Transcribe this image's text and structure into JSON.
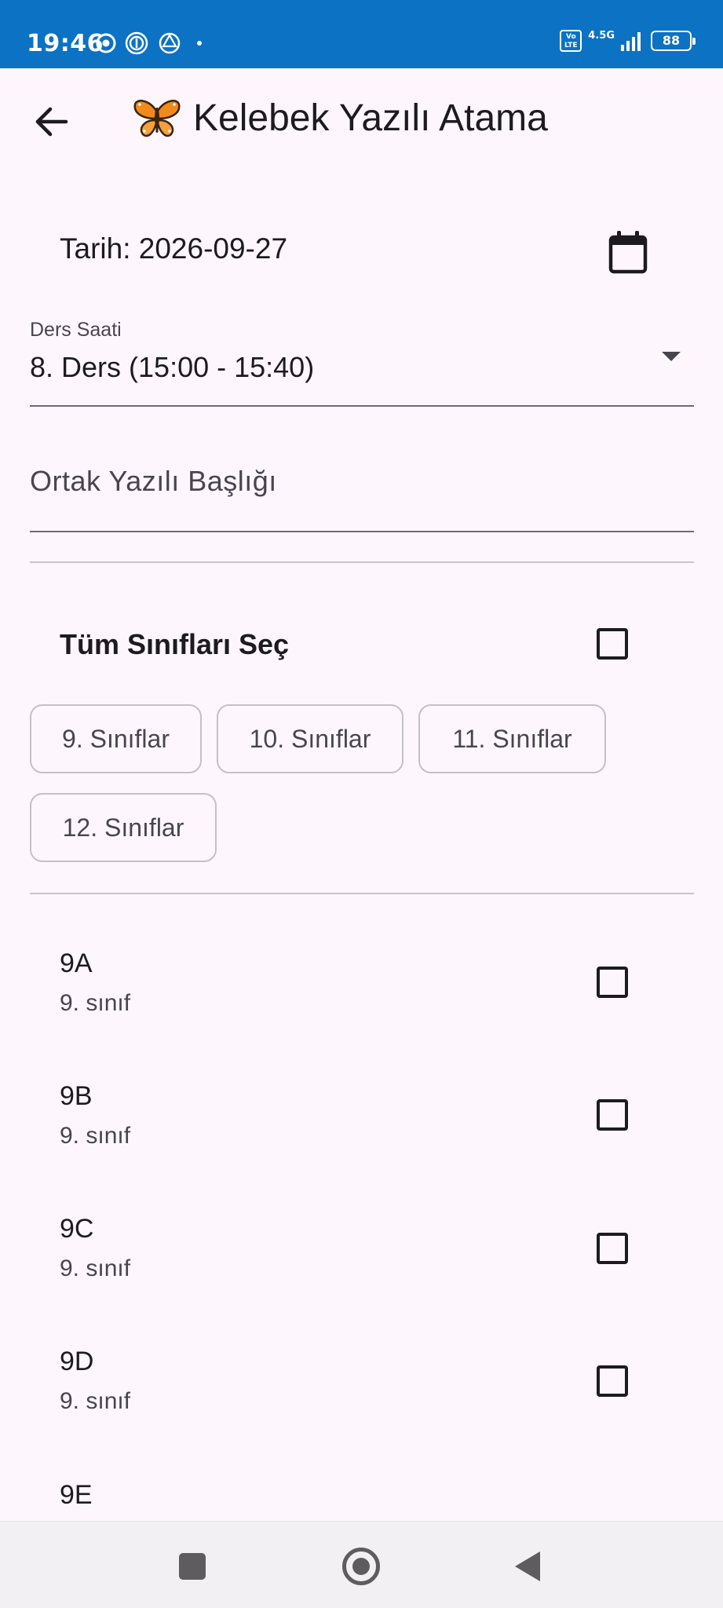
{
  "status_bar": {
    "time": "19:46",
    "network": "4.5G",
    "volte": "Vo LTE",
    "battery": "88"
  },
  "app_bar": {
    "title": "Kelebek Yazılı Atama",
    "title_icon": "butterfly-icon",
    "back_icon": "arrow-left-icon"
  },
  "form": {
    "date_label": "Tarih: 2026-09-27",
    "calendar_icon": "calendar-icon",
    "lesson": {
      "label": "Ders Saati",
      "value": "8. Ders (15:00 - 15:40)"
    },
    "title_field": {
      "placeholder": "Ortak Yazılı Başlığı",
      "value": ""
    }
  },
  "select_all": {
    "label": "Tüm Sınıfları Seç",
    "checked": false
  },
  "grade_chips": [
    {
      "label": "9. Sınıflar"
    },
    {
      "label": "10. Sınıflar"
    },
    {
      "label": "11. Sınıflar"
    },
    {
      "label": "12. Sınıflar"
    }
  ],
  "classes": [
    {
      "name": "9A",
      "grade": "9. sınıf",
      "checked": false
    },
    {
      "name": "9B",
      "grade": "9. sınıf",
      "checked": false
    },
    {
      "name": "9C",
      "grade": "9. sınıf",
      "checked": false
    },
    {
      "name": "9D",
      "grade": "9. sınıf",
      "checked": false
    },
    {
      "name": "9E"
    }
  ],
  "colors": {
    "status_bar": "#0b72c4",
    "background": "#fdf7fd",
    "text": "#1d1b20",
    "secondary_text": "#49454f"
  }
}
